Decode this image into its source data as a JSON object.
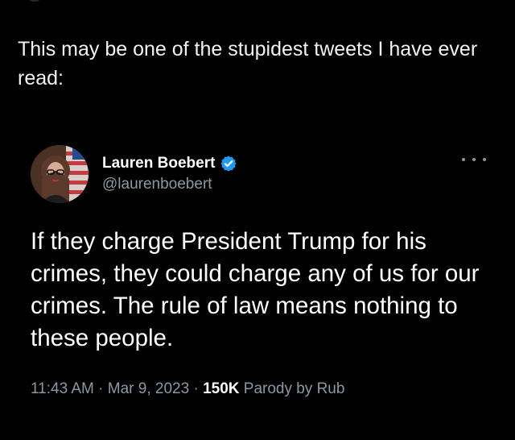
{
  "caption": {
    "text": "This may be one of the stupidest tweets I have ever read:"
  },
  "tweet": {
    "author": {
      "display_name": "Lauren Boebert",
      "handle": "@laurenboebert",
      "verified_icon": "verified-badge-icon",
      "avatar_icon": "profile-photo-avatar"
    },
    "more_icon": "more-options-icon",
    "text": "If they charge President Trump for his crimes, they could charge any of us for our crimes. The rule of law means nothing to these people.",
    "meta": {
      "time": "11:43 AM",
      "separator": "·",
      "date": "Mar 9, 2023",
      "views": "150K",
      "views_label": "Parody by Rub"
    }
  },
  "colors": {
    "background": "#000000",
    "text": "#ffffff",
    "secondary_text": "#8b98a5",
    "verified_badge": "#1d9bf0"
  }
}
